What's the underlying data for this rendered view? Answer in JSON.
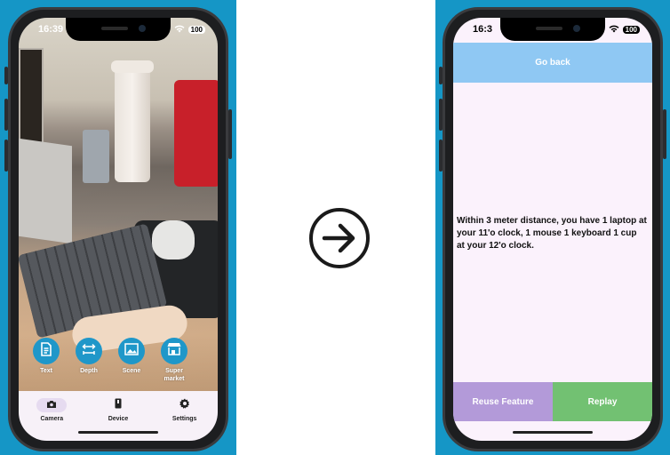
{
  "left_phone": {
    "status": {
      "time": "16:39",
      "battery": "100"
    },
    "modes": [
      {
        "label": "Text",
        "icon": "document-icon"
      },
      {
        "label": "Depth",
        "icon": "depth-icon"
      },
      {
        "label": "Scene",
        "icon": "image-icon"
      },
      {
        "label": "Super market",
        "icon": "store-icon"
      }
    ],
    "tabs": [
      {
        "label": "Camera",
        "icon": "camera-icon",
        "active": true
      },
      {
        "label": "Device",
        "icon": "device-icon",
        "active": false
      },
      {
        "label": "Settings",
        "icon": "gear-icon",
        "active": false
      }
    ]
  },
  "transition": {
    "icon": "arrow-right-circle-icon"
  },
  "right_phone": {
    "status": {
      "time": "16:3",
      "battery": "100"
    },
    "go_back_label": "Go back",
    "message": "Within 3 meter distance, you have 1 laptop at your 11'o clock, 1 mouse 1 keyboard 1 cup at your 12'o clock.",
    "reuse_label": "Reuse Feature",
    "replay_label": "Replay"
  },
  "colors": {
    "panel_bg": "#1596c6",
    "mode_button": "#1f97c9",
    "go_back_bg": "#8fc8f3",
    "reuse_bg": "#b39ad9",
    "replay_bg": "#72c172",
    "screen_bg": "#fbf2fc"
  }
}
